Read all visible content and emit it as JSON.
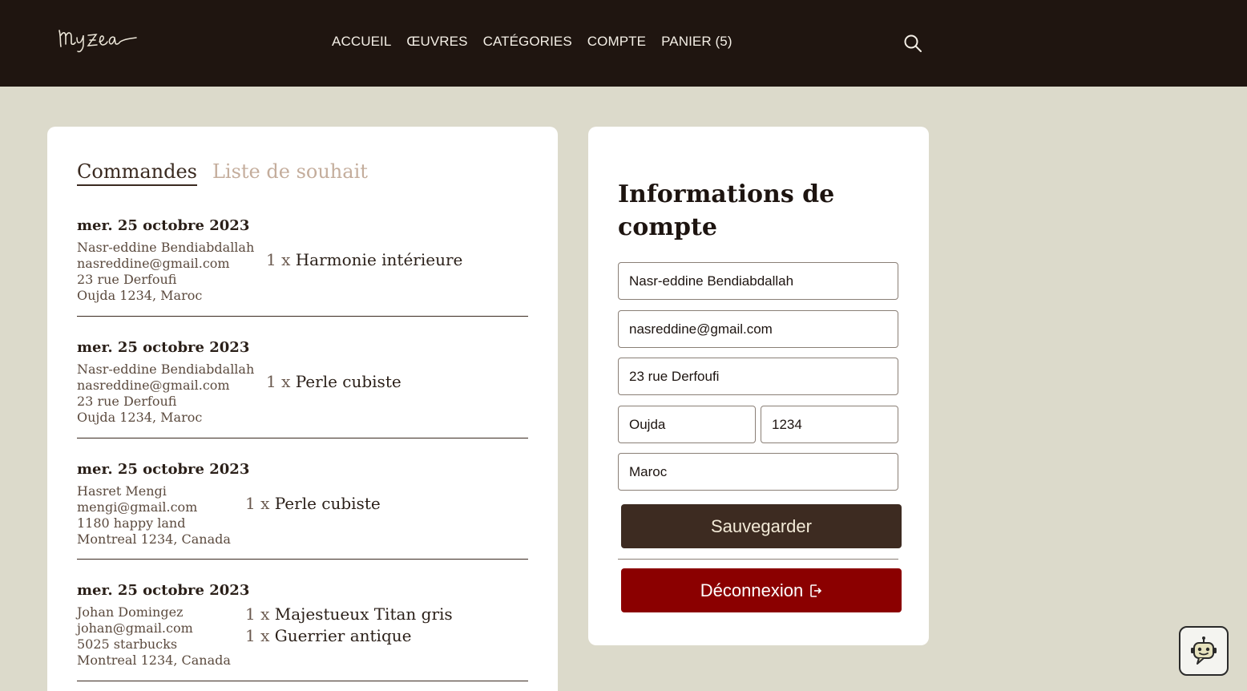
{
  "brand": {
    "logo_text": "muzea"
  },
  "nav": {
    "items": [
      {
        "label": "ACCUEIL"
      },
      {
        "label": "ŒUVRES"
      },
      {
        "label": "CATÉGORIES"
      },
      {
        "label": "COMPTE"
      },
      {
        "label": "PANIER (5)"
      }
    ],
    "search_icon": "search-icon"
  },
  "tabs": {
    "orders": "Commandes",
    "wishlist": "Liste de souhait"
  },
  "orders": [
    {
      "date": "mer. 25 octobre 2023",
      "address": [
        "Nasr-eddine Bendiabdallah",
        "nasreddine@gmail.com",
        "23 rue Derfoufi",
        "Oujda 1234, Maroc"
      ],
      "items": [
        {
          "qty": "1 x",
          "name": "Harmonie intérieure"
        }
      ]
    },
    {
      "date": "mer. 25 octobre 2023",
      "address": [
        "Nasr-eddine Bendiabdallah",
        "nasreddine@gmail.com",
        "23 rue Derfoufi",
        "Oujda 1234, Maroc"
      ],
      "items": [
        {
          "qty": "1 x",
          "name": "Perle cubiste"
        }
      ]
    },
    {
      "date": "mer. 25 octobre 2023",
      "address": [
        "Hasret Mengi",
        "mengi@gmail.com",
        "1180 happy land",
        "Montreal 1234, Canada"
      ],
      "items": [
        {
          "qty": "1 x",
          "name": "Perle cubiste"
        }
      ]
    },
    {
      "date": "mer. 25 octobre 2023",
      "address": [
        "Johan Domingez",
        "johan@gmail.com",
        "5025 starbucks",
        "Montreal 1234, Canada"
      ],
      "items": [
        {
          "qty": "1 x",
          "name": "Majestueux Titan gris"
        },
        {
          "qty": "1 x",
          "name": "Guerrier antique"
        }
      ]
    }
  ],
  "account": {
    "title": "Informations de compte",
    "fields": {
      "name": "Nasr-eddine Bendiabdallah",
      "email": "nasreddine@gmail.com",
      "street": "23 rue Derfoufi",
      "city": "Oujda",
      "postal": "1234",
      "country": "Maroc"
    },
    "save_label": "Sauvegarder",
    "logout_label": "Déconnexion"
  },
  "colors": {
    "header_bg": "#1f1510",
    "page_bg": "#dcdacb",
    "save_button": "#3d2b21",
    "logout_button": "#8b0000",
    "inactive_tab": "#c4ad9c"
  }
}
